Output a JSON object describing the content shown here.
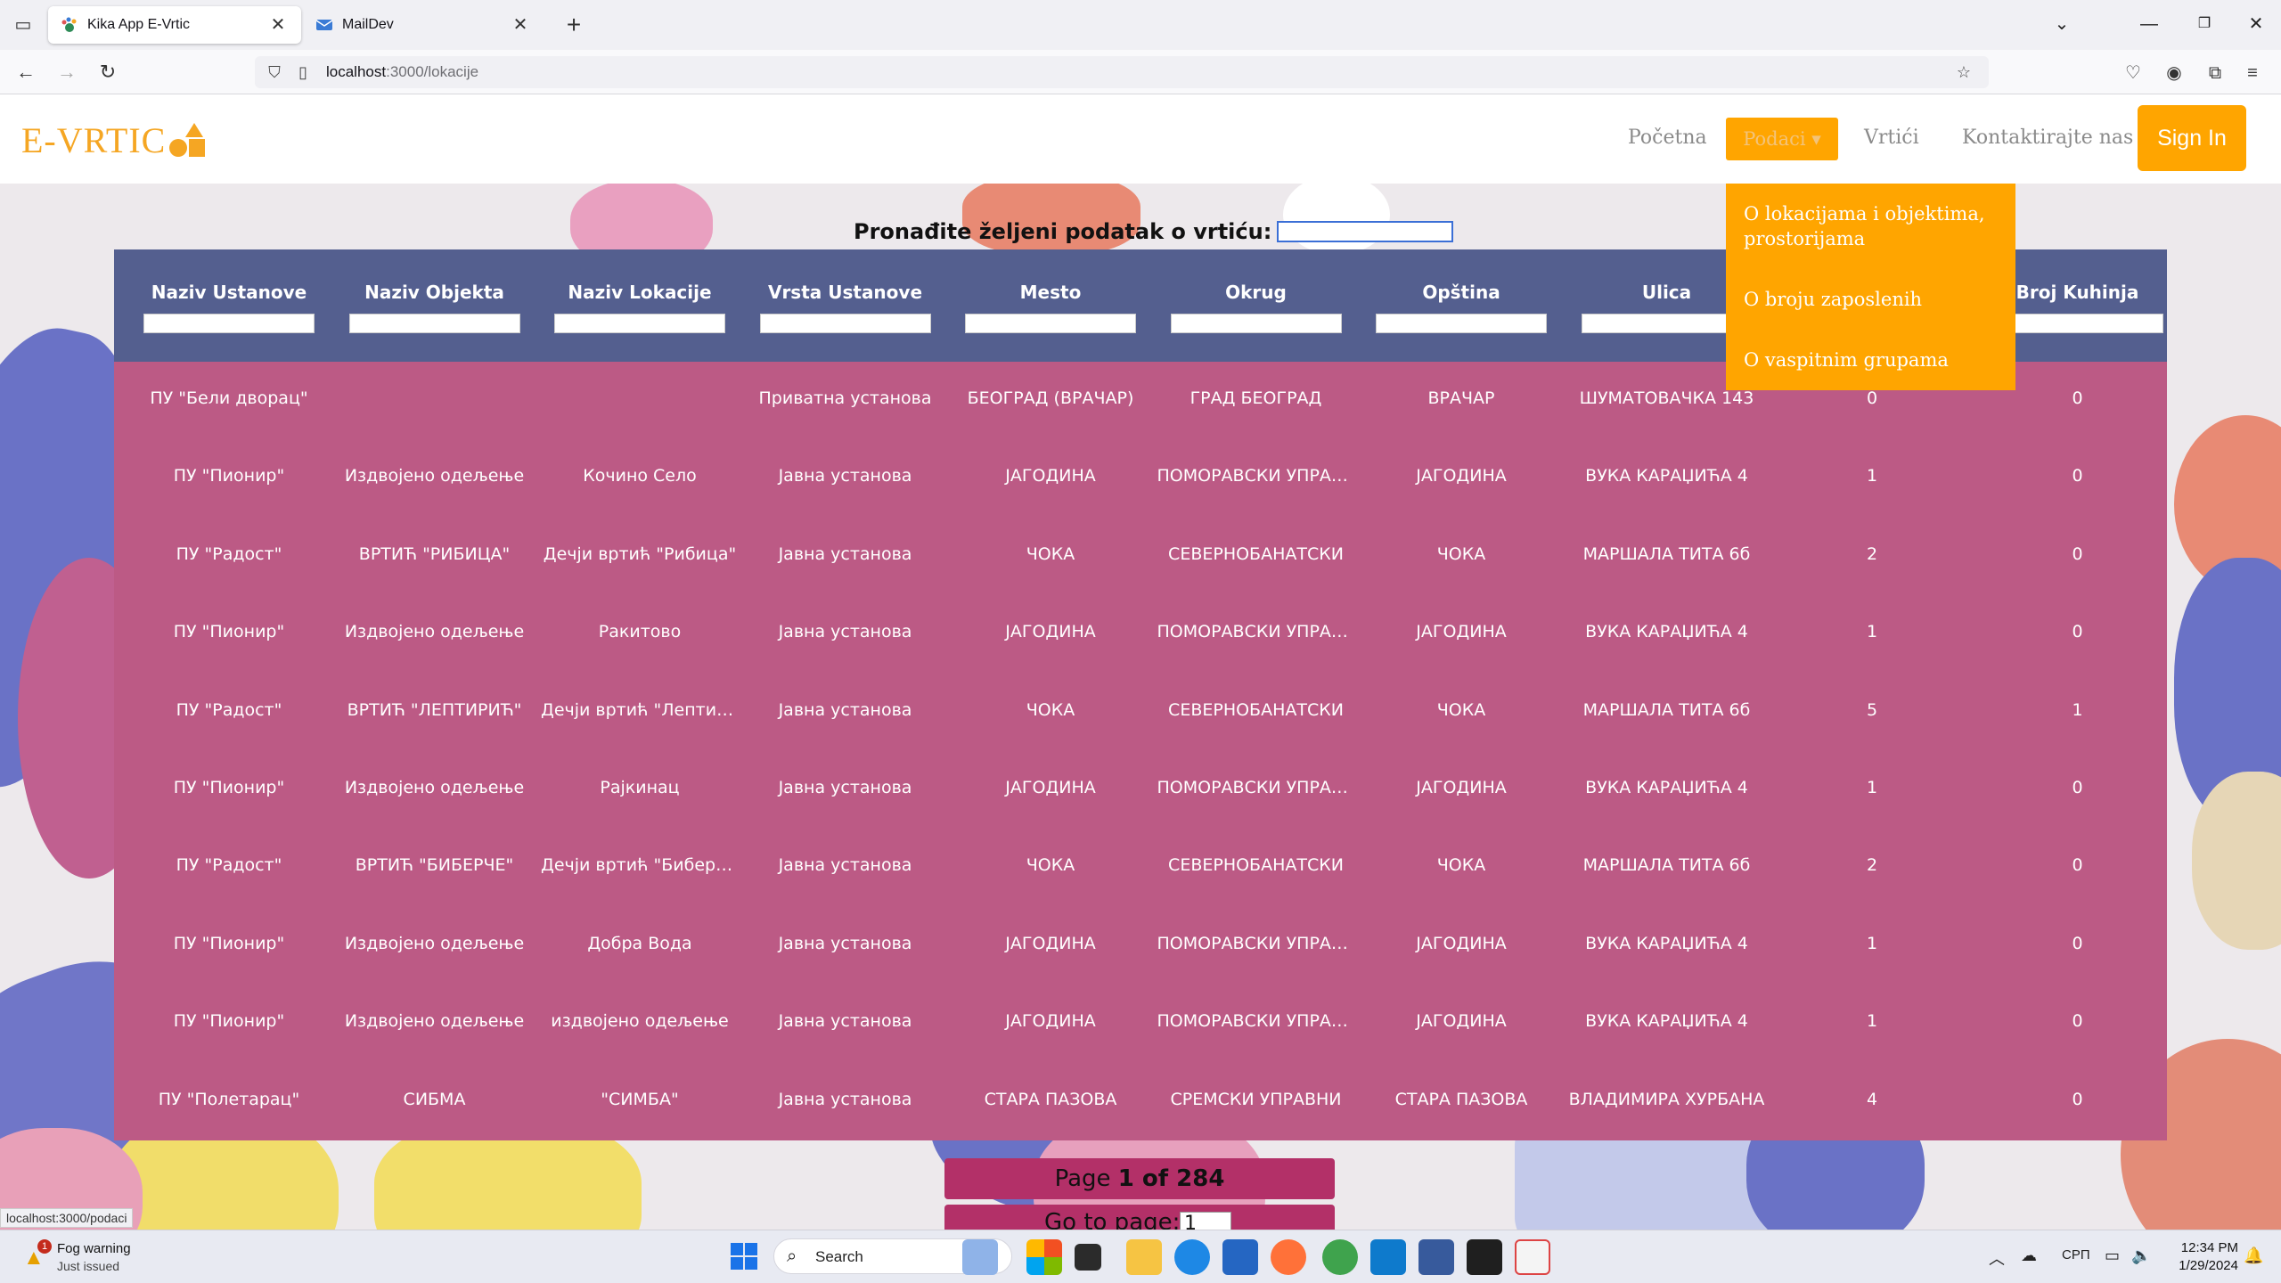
{
  "browser": {
    "tabs": [
      {
        "title": "Kika App E-Vrtic",
        "active": true
      },
      {
        "title": "MailDev",
        "active": false
      }
    ],
    "url_host": "localhost",
    "url_path": ":3000/lokacije",
    "status_link": "localhost:3000/podaci"
  },
  "site": {
    "logo": "E-VRTIC",
    "nav": {
      "home": "Početna",
      "data": "Podaci",
      "kindergartens": "Vrtići",
      "contact": "Kontaktirajte nas",
      "signin": "Sign In"
    },
    "dropdown": [
      "O lokacijama i objektima, prostorijama",
      "O broju zaposlenih",
      "O vaspitnim grupama"
    ],
    "search_label": "Pronađite željeni podatak o vrtiću:",
    "columns": [
      "Naziv Ustanove",
      "Naziv Objekta",
      "Naziv Lokacije",
      "Vrsta Ustanove",
      "Mesto",
      "Okrug",
      "Opština",
      "Ulica",
      "",
      "Broj Kuhinja"
    ],
    "rows": [
      [
        "ПУ \"Бели дворац\"",
        "",
        "",
        "Приватна установа",
        "БЕОГРАД (ВРАЧАР)",
        "ГРАД БЕОГРАД",
        "ВРАЧАР",
        "ШУМАТОВАЧКА 143",
        "0",
        "0"
      ],
      [
        "ПУ \"Пионир\"",
        "Издвојено одељење",
        "Кочино Село",
        "Јавна установа",
        "ЈАГОДИНА",
        "ПОМОРАВСКИ УПРАВНИ",
        "ЈАГОДИНА",
        "ВУКА КАРАЏИЋА 4",
        "1",
        "0"
      ],
      [
        "ПУ \"Радост\"",
        "ВРТИЋ \"РИБИЦА\"",
        "Дечји вртић \"Рибица\"",
        "Јавна установа",
        "ЧОКА",
        "СЕВЕРНОБАНАТСКИ",
        "ЧОКА",
        "МАРШАЛА ТИТА 6б",
        "2",
        "0"
      ],
      [
        "ПУ \"Пионир\"",
        "Издвојено одељење",
        "Ракитово",
        "Јавна установа",
        "ЈАГОДИНА",
        "ПОМОРАВСКИ УПРАВНИ",
        "ЈАГОДИНА",
        "ВУКА КАРАЏИЋА 4",
        "1",
        "0"
      ],
      [
        "ПУ \"Радост\"",
        "ВРТИЋ \"ЛЕПТИРИЋ\"",
        "Дечји вртић \"Лептирић\"",
        "Јавна установа",
        "ЧОКА",
        "СЕВЕРНОБАНАТСКИ",
        "ЧОКА",
        "МАРШАЛА ТИТА 6б",
        "5",
        "1"
      ],
      [
        "ПУ \"Пионир\"",
        "Издвојено одељење",
        "Рајкинац",
        "Јавна установа",
        "ЈАГОДИНА",
        "ПОМОРАВСКИ УПРАВНИ",
        "ЈАГОДИНА",
        "ВУКА КАРАЏИЋА 4",
        "1",
        "0"
      ],
      [
        "ПУ \"Радост\"",
        "ВРТИЋ \"БИБЕРЧЕ\"",
        "Дечји вртић \"Биберче\"",
        "Јавна установа",
        "ЧОКА",
        "СЕВЕРНОБАНАТСКИ",
        "ЧОКА",
        "МАРШАЛА ТИТА 6б",
        "2",
        "0"
      ],
      [
        "ПУ \"Пионир\"",
        "Издвојено одељење",
        "Добра Вода",
        "Јавна установа",
        "ЈАГОДИНА",
        "ПОМОРАВСКИ УПРАВНИ",
        "ЈАГОДИНА",
        "ВУКА КАРАЏИЋА 4",
        "1",
        "0"
      ],
      [
        "ПУ \"Пионир\"",
        "Издвојено одељење",
        "издвојено одељење",
        "Јавна установа",
        "ЈАГОДИНА",
        "ПОМОРАВСКИ УПРАВНИ",
        "ЈАГОДИНА",
        "ВУКА КАРАЏИЋА 4",
        "1",
        "0"
      ],
      [
        "ПУ \"Полетарац\"",
        "СИБМА",
        "\"СИМБА\"",
        "Јавна установа",
        "СТАРА ПАЗОВА",
        "СРЕМСКИ УПРАВНИ",
        "СТАРА ПАЗОВА",
        "ВЛАДИМИРА ХУРБАНА",
        "4",
        "0"
      ]
    ],
    "pager": {
      "prefix": "Page ",
      "current": "1",
      "of": " of ",
      "total": "284"
    },
    "goto_label": "Go to page:",
    "goto_value": "1"
  },
  "taskbar": {
    "weather_title": "Fog warning",
    "weather_sub": "Just issued",
    "weather_badge": "1",
    "search": "Search",
    "lang": "СРП",
    "time": "12:34 PM",
    "date": "1/29/2024"
  },
  "colors": {
    "accent": "#ffa500",
    "table_header": "#545f8f",
    "table_body": "#bc5a85",
    "pager": "#b33068"
  }
}
